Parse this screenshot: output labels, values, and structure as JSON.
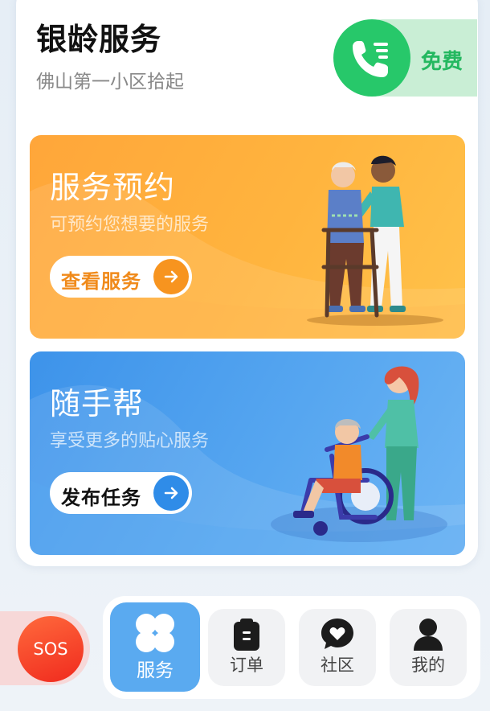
{
  "header": {
    "title": "银龄服务",
    "subtitle": "佛山第一小区拾起",
    "call_label": "免费",
    "call_icon": "phone-icon"
  },
  "cards": [
    {
      "title": "服务预约",
      "desc": "可预约您想要的服务",
      "button_label": "查看服务",
      "color": "#ffa63a"
    },
    {
      "title": "随手帮",
      "desc": "享受更多的贴心服务",
      "button_label": "发布任务",
      "color": "#3d93ea"
    }
  ],
  "sos": {
    "label": "SOS"
  },
  "nav": {
    "items": [
      {
        "label": "服务",
        "icon": "clover-icon",
        "active": true
      },
      {
        "label": "订单",
        "icon": "clipboard-icon",
        "active": false
      },
      {
        "label": "社区",
        "icon": "heart-chat-icon",
        "active": false
      },
      {
        "label": "我的",
        "icon": "person-icon",
        "active": false
      }
    ]
  }
}
